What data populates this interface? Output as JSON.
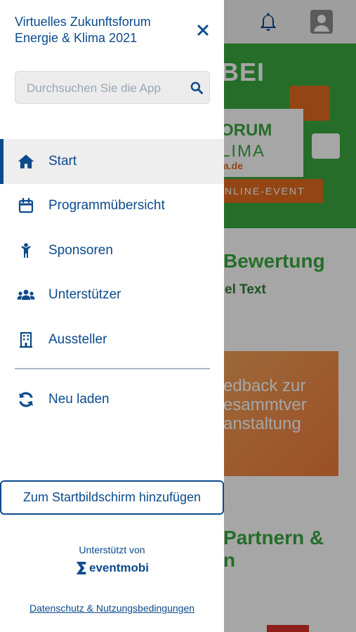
{
  "colors": {
    "primary": "#0b4a8c",
    "green": "#3aa83f",
    "orange": "#e36b20",
    "active_bg": "#eeeeee"
  },
  "drawer": {
    "title": "Virtuelles Zukunftsforum Energie & Klima 2021",
    "close_icon": "close-icon",
    "search": {
      "placeholder": "Durchsuchen Sie die App",
      "value": "",
      "icon": "search-icon"
    },
    "nav_items": [
      {
        "label": "Start",
        "icon": "home-icon",
        "active": true
      },
      {
        "label": "Programmübersicht",
        "icon": "calendar-icon",
        "active": false
      },
      {
        "label": "Sponsoren",
        "icon": "person-icon",
        "active": false
      },
      {
        "label": "Unterstützer",
        "icon": "users-icon",
        "active": false
      },
      {
        "label": "Aussteller",
        "icon": "building-icon",
        "active": false
      }
    ],
    "reload": {
      "label": "Neu laden",
      "icon": "refresh-icon"
    },
    "add_home_button": "Zum Startbildschirm hinzufügen",
    "powered_by": "Unterstützt von",
    "brand": "eventmobi",
    "privacy_link": "Datenschutz & Nutzungsbedingungen"
  },
  "background": {
    "bell_icon": "bell-icon",
    "avatar_icon": "avatar-icon",
    "banner_text": "BEI",
    "banner_forum": "ORUM",
    "banner_klima": "LIMA",
    "banner_url": "a.de",
    "banner_online": "NLINE-EVENT",
    "title": "Bewertung",
    "subtitle": "el Text",
    "feedback_text": "edback zur\nesammtver\nanstaltung",
    "partner_text": "Partnern &\nn"
  }
}
